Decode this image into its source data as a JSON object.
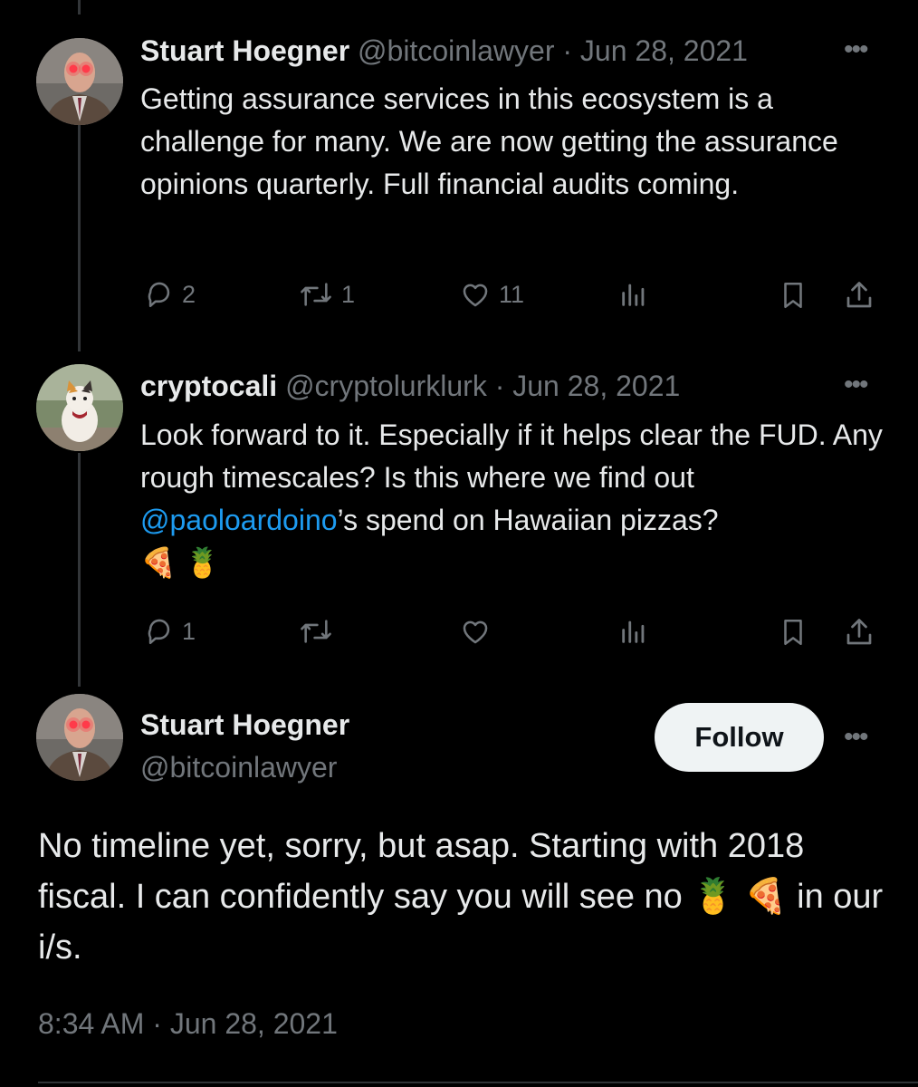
{
  "tweets": [
    {
      "name": "Stuart Hoegner",
      "handle": "@bitcoinlawyer",
      "date": "· Jun 28, 2021",
      "text": "Getting assurance services in this ecosystem is a challenge for many. We are now getting the assurance opinions quarterly. Full financial audits coming.",
      "replies": "2",
      "retweets": "1",
      "likes": "11",
      "avatar_icon": "profile-photo-man-suit"
    },
    {
      "name": "cryptocali",
      "handle": "@cryptolurklurk",
      "date": "· Jun 28, 2021",
      "text_before": "Look forward to it. Especially if it helps clear the FUD. Any rough timescales? Is this where we find out ",
      "mention": "@paoloardoino",
      "text_after": "’s spend on Hawaiian pizzas?",
      "emoji_line": "🍕 🍍",
      "replies": "1",
      "retweets": "",
      "likes": "",
      "avatar_icon": "profile-photo-cat"
    }
  ],
  "main_tweet": {
    "name": "Stuart Hoegner",
    "handle": "@bitcoinlawyer",
    "follow_label": "Follow",
    "text_part1": "No timeline yet, sorry, but asap. Starting with 2018 fiscal. I can confidently say you will see no ",
    "emoji_1": "🍍",
    "emoji_2": "🍕",
    "text_part2": " in our i/s.",
    "timestamp": "8:34 AM · Jun 28, 2021"
  },
  "icons": {
    "reply": "reply-icon",
    "retweet": "retweet-icon",
    "like": "heart-icon",
    "analytics": "analytics-icon",
    "bookmark": "bookmark-icon",
    "share": "share-icon",
    "more": "more-icon"
  },
  "colors": {
    "background": "#000000",
    "text": "#e7e9ea",
    "muted": "#71767b",
    "link": "#1d9bf0",
    "follow_bg": "#eff3f4"
  }
}
